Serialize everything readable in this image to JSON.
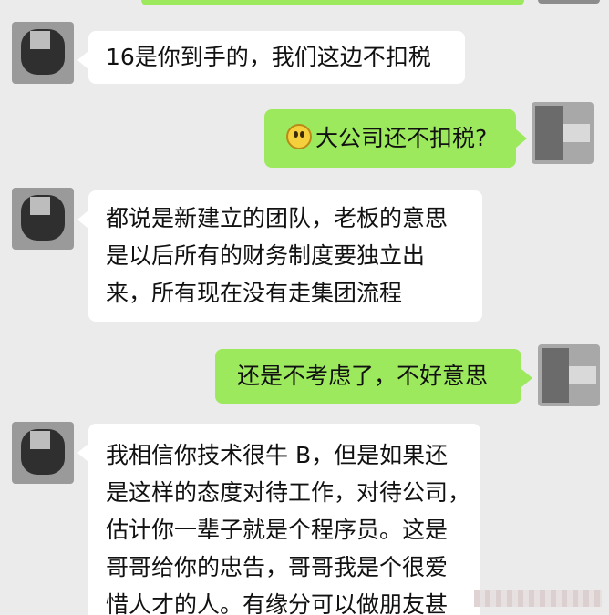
{
  "messages": [
    {
      "side": "in",
      "lines": [
        "16是你到手的，我们这边不扣税"
      ]
    },
    {
      "side": "out",
      "emoji": "smiley-emoji",
      "lines": [
        "大公司还不扣税?"
      ]
    },
    {
      "side": "in",
      "lines": [
        "都说是新建立的团队，老板的意思",
        "是以后所有的财务制度要独立出",
        "来，所有现在没有走集团流程"
      ]
    },
    {
      "side": "out",
      "lines": [
        "还是不考虑了，不好意思"
      ]
    },
    {
      "side": "in",
      "lines": [
        "我相信你技术很牛 B，但是如果还",
        "是这样的态度对待工作，对待公司，",
        "估计你一辈子就是个程序员。这是",
        "哥哥给你的忠告，哥哥我是个很爱",
        "惜人才的人。有缘分可以做朋友甚"
      ]
    }
  ],
  "colors": {
    "background": "#ebebeb",
    "incoming": "#ffffff",
    "outgoing": "#9de95d"
  }
}
